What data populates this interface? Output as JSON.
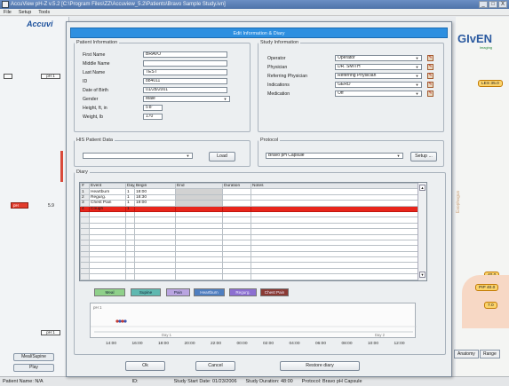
{
  "window": {
    "title": "AccuView pH-Z v.5.2 [C:\\Program Files\\ZZ\\Accuview_5.2\\Patients\\Bravo Sample Study.ivn]",
    "controls": [
      "_",
      "□",
      "X"
    ]
  },
  "menu": [
    "File",
    "Setup",
    "Tools"
  ],
  "left_panel": {
    "logo": "Accuvi",
    "channel_tag": "pH 1",
    "marker_label": "pH",
    "marker_value": "5.9",
    "lower_tag": "pH 1",
    "buttons": [
      "Meal/Supine",
      "Play"
    ]
  },
  "right_panel": {
    "logo": "GIvEN",
    "logo_sub": "Imaging",
    "badges": [
      "LES 35.0",
      "40.0",
      "PIP 40.0",
      "7.0"
    ],
    "faint_label": "Esophagus",
    "buttons": [
      "Anatomy",
      "Range"
    ]
  },
  "dialog": {
    "title": "Edit Information & Diary",
    "patient": {
      "legend": "Patient Information",
      "fields": [
        {
          "label": "First Name",
          "value": "BRAVO"
        },
        {
          "label": "Middle Name",
          "value": ""
        },
        {
          "label": "Last Name",
          "value": "TEST"
        },
        {
          "label": "ID",
          "value": "884011"
        },
        {
          "label": "Date of Birth",
          "value": "01/28/2001"
        },
        {
          "label": "Gender",
          "value": "Male"
        },
        {
          "label": "Height, ft, in",
          "value": "5'8\""
        },
        {
          "label": "Weight, lb",
          "value": "170"
        }
      ]
    },
    "study": {
      "legend": "Study Information",
      "fields": [
        {
          "label": "Operator",
          "value": "Operator"
        },
        {
          "label": "Physician",
          "value": "DR. SMITH"
        },
        {
          "label": "Referring Physician",
          "value": "Referring Physician"
        },
        {
          "label": "Indications",
          "value": "GERD"
        },
        {
          "label": "Medication",
          "value": "Off"
        }
      ]
    },
    "his": {
      "legend": "HIS Patient Data",
      "value": "",
      "load_label": "Load"
    },
    "protocol": {
      "legend": "Protocol",
      "value": "Bravo pH Capsule",
      "setup_label": "Setup ..."
    },
    "diary": {
      "legend": "Diary",
      "headers": [
        "#",
        "Event",
        "Day",
        "Begin",
        "End",
        "Duration",
        "Notes"
      ],
      "rows": [
        [
          "1",
          "Heartburn",
          "1",
          "18:00",
          "",
          "",
          ""
        ],
        [
          "2",
          "Regurg.",
          "1",
          "18:30",
          "",
          "",
          ""
        ],
        [
          "3",
          "Chest Pain",
          "1",
          "19:00",
          "",
          "",
          ""
        ],
        [
          "4",
          "Cough",
          "1",
          "",
          "",
          "",
          ""
        ],
        [
          "",
          "",
          "",
          "",
          "",
          "",
          ""
        ],
        [
          "",
          "",
          "",
          "",
          "",
          "",
          ""
        ],
        [
          "",
          "",
          "",
          "",
          "",
          "",
          ""
        ],
        [
          "",
          "",
          "",
          "",
          "",
          "",
          ""
        ],
        [
          "",
          "",
          "",
          "",
          "",
          "",
          ""
        ],
        [
          "",
          "",
          "",
          "",
          "",
          "",
          ""
        ],
        [
          "",
          "",
          "",
          "",
          "",
          "",
          ""
        ],
        [
          "",
          "",
          "",
          "",
          "",
          "",
          ""
        ],
        [
          "",
          "",
          "",
          "",
          "",
          "",
          ""
        ],
        [
          "",
          "",
          "",
          "",
          "",
          "",
          ""
        ],
        [
          "",
          "",
          "",
          "",
          "",
          "",
          ""
        ],
        [
          "",
          "",
          "",
          "",
          "",
          "",
          ""
        ]
      ],
      "selected_row": 3
    },
    "event_buttons": [
      {
        "label": "Meal",
        "color": "#8fd08a"
      },
      {
        "label": "Supine",
        "color": "#5fb8b0"
      },
      {
        "label": "Pain",
        "color": "#b9a4e0"
      },
      {
        "label": "Heartburn",
        "color": "#4f7fc0"
      },
      {
        "label": "Regurg.",
        "color": "#8c6fd1"
      },
      {
        "label": "Chest Pain",
        "color": "#8a3a34"
      }
    ],
    "timeline": {
      "left_label": "pH 1",
      "ticks": [
        "14:00",
        "16:00",
        "18:00",
        "20:00",
        "22:00",
        "00:00",
        "02:00",
        "04:00",
        "06:00",
        "08:00",
        "10:00",
        "12:00"
      ],
      "bottom_label": "Day 1",
      "right_label": "Day 2"
    },
    "footer": {
      "ok": "Ok",
      "cancel": "Cancel",
      "restore": "Restore diary"
    }
  },
  "status": {
    "patient": "Patient Name: N/A",
    "id": "ID:",
    "start": "Study Start Date: 01/23/2006",
    "duration": "Study Duration: 48:00",
    "protocol": "Protocol: Bravo pH Capsule"
  },
  "colors": {
    "dialog_title_bg": "#2d8fe0",
    "selected_row": "#e8251b",
    "marker": "#e23b2c"
  }
}
